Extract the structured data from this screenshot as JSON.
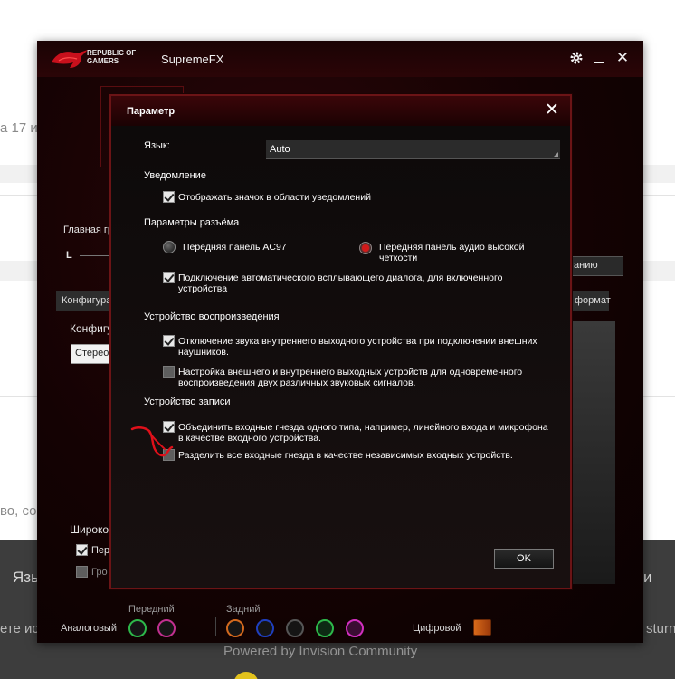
{
  "background_page": {
    "snippet_top": "а 17 и",
    "snippet_mid": "во, со",
    "footer_language": "Язы",
    "footer_right_letter": "и",
    "footer_left_text": "ете ис",
    "footer_right_text": "sturn",
    "powered_by": "Powered by Invision Community"
  },
  "app": {
    "logo_text_line1": "REPUBLIC OF",
    "logo_text_line2": "GAMERS",
    "title": "SupremeFX",
    "settings_icon": "gear-icon",
    "minimize_icon": "minimize-icon",
    "close_icon": "close-icon",
    "main_group_label": "Главная гр",
    "channel_label": "L",
    "config_tab": "Конфигура",
    "config_label": "Конфигу",
    "config_value": "Стерео",
    "format_tab": "формат",
    "default_select": "анию",
    "wide_label": "Широко",
    "wide_option1": "Пере",
    "wide_option2": "Гро",
    "front_label": "Передний",
    "rear_label": "Задний",
    "analog_label": "Аналоговый",
    "digital_label": "Цифровой",
    "front_jacks": [
      "#2db84a",
      "#c0308f"
    ],
    "rear_jacks": [
      "#d2691e",
      "#1f3fbf",
      "#2a2a2a",
      "#2db84a",
      "#d12fbf"
    ]
  },
  "dialog": {
    "title": "Параметр",
    "close_icon": "close-icon",
    "language_label": "Язык:",
    "language_value": "Auto",
    "notification_section": "Уведомление",
    "notification_option": "Отображать значок в области уведомлений",
    "connector_section": "Параметры разъёма",
    "radio_ac97": "Передняя панель AC97",
    "radio_hd_line1": "Передняя панель аудио высокой",
    "radio_hd_line2": "четкости",
    "auto_popup_line1": "Подключение автоматического всплывающего диалога, для включенного",
    "auto_popup_line2": "устройства",
    "playback_section": "Устройство воспроизведения",
    "mute_internal_line1": "Отключение звука внутреннего выходного устройства при подключении внешних",
    "mute_internal_line2": "наушников.",
    "dual_output_line1": "Настройка внешнего и внутреннего выходных устройств для одновременного",
    "dual_output_line2": "воспроизведения двух различных звуковых сигналов.",
    "recording_section": "Устройство записи",
    "combine_inputs_line1": "Объединить входные гнезда одного типа, например, линейного входа и микрофона",
    "combine_inputs_line2": "в качестве входного устройства.",
    "separate_inputs": "Разделить все входные гнезда в качестве независимых входных устройств.",
    "ok_label": "OK",
    "states": {
      "notification_checked": true,
      "ac97_selected": false,
      "hd_selected": true,
      "auto_popup_checked": true,
      "mute_internal_checked": true,
      "dual_output_checked": false,
      "combine_inputs_checked": true,
      "separate_inputs_checked": false
    }
  },
  "annotation_color": "#e0101a"
}
